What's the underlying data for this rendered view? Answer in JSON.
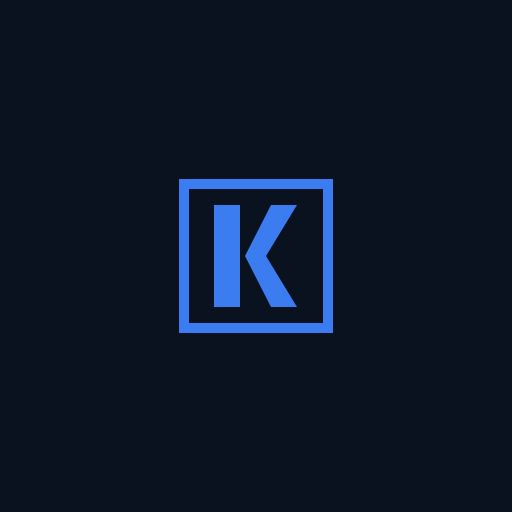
{
  "background_color": "#0a1220",
  "logo": {
    "icon": "letter-k-logo-icon",
    "letter": "K",
    "color": "#3b7cf0"
  }
}
